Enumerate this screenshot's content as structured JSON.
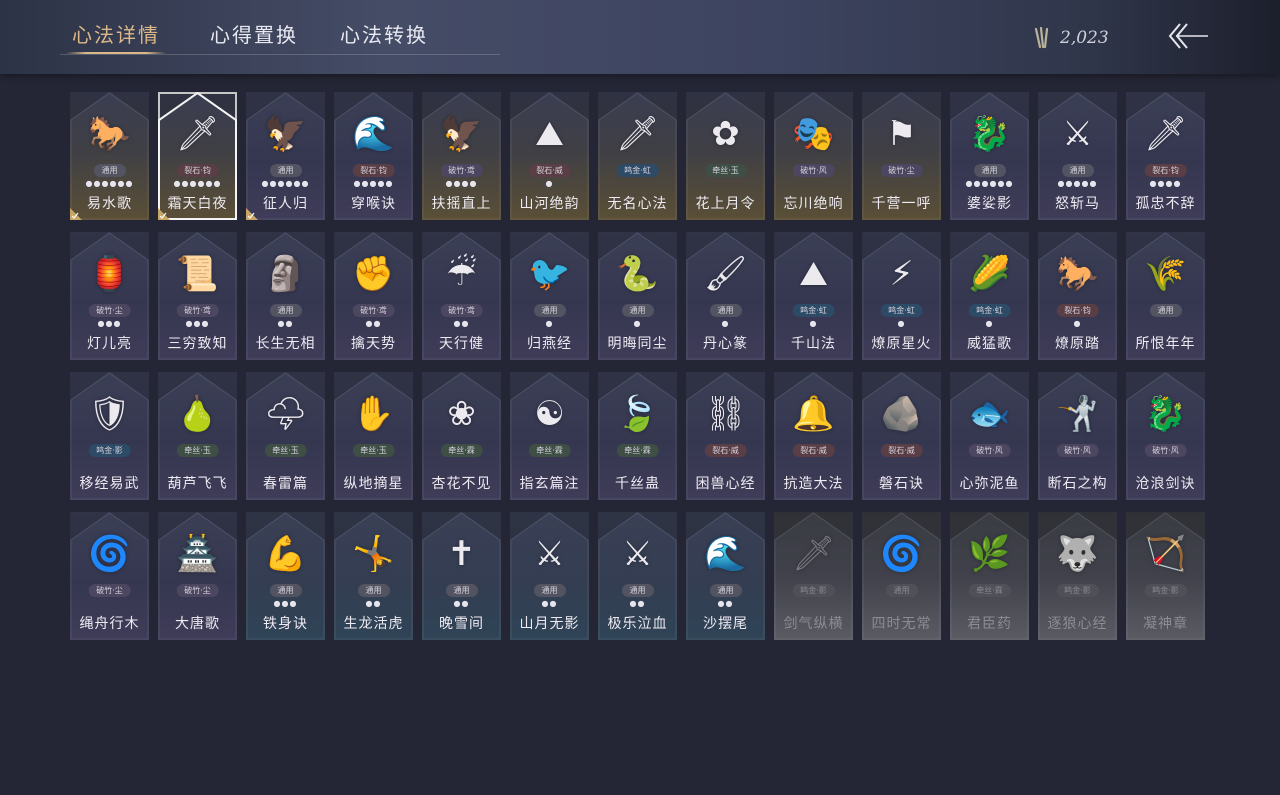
{
  "tabs": [
    {
      "label": "心法详情",
      "active": true
    },
    {
      "label": "心得置换",
      "active": false
    },
    {
      "label": "心法转换",
      "active": false
    }
  ],
  "currency": {
    "amount": "2,023",
    "icon": "arrows-bundle-icon"
  },
  "back_icon": "back-arrow-icon",
  "colors": {
    "accent": "#dcb889",
    "background": "#242635"
  },
  "cards": [
    {
      "name": "易水歌",
      "tag": "通用",
      "tagType": "general",
      "dots": "●●●●●●",
      "theme": "gold",
      "art": "🐎",
      "icon": "horse-icon",
      "check": true
    },
    {
      "name": "霜天白夜",
      "tag": "裂石·钧",
      "tagType": "red",
      "dots": "●●●●●●",
      "theme": "gold",
      "art": "🗡",
      "icon": "sword-icon",
      "check": true,
      "selected": true
    },
    {
      "name": "征人归",
      "tag": "通用",
      "tagType": "general",
      "dots": "●●●●●●",
      "theme": "normal",
      "art": "🦅",
      "icon": "eagle-icon",
      "check": true
    },
    {
      "name": "穿喉诀",
      "tag": "裂石·钧",
      "tagType": "red",
      "dots": "●●●●●",
      "theme": "normal",
      "art": "🌊",
      "icon": "wave-icon"
    },
    {
      "name": "扶摇直上",
      "tag": "破竹·鸢",
      "tagType": "purple",
      "dots": "●●●●",
      "theme": "gold",
      "art": "🦅",
      "icon": "bird-icon"
    },
    {
      "name": "山河绝韵",
      "tag": "裂石·威",
      "tagType": "red",
      "dots": "●",
      "theme": "gold",
      "art": "⛰",
      "icon": "mountain-icon"
    },
    {
      "name": "无名心法",
      "tag": "鸣金·虹",
      "tagType": "blue",
      "dots": "",
      "theme": "gold",
      "art": "🗡",
      "icon": "dagger-icon"
    },
    {
      "name": "花上月令",
      "tag": "牵丝·玉",
      "tagType": "green",
      "dots": "",
      "theme": "gold",
      "art": "✿",
      "icon": "flower-moon-icon"
    },
    {
      "name": "忘川绝响",
      "tag": "破竹·风",
      "tagType": "purple",
      "dots": "",
      "theme": "gold",
      "art": "🎭",
      "icon": "mask-icon"
    },
    {
      "name": "千营一呼",
      "tag": "破竹·尘",
      "tagType": "purple",
      "dots": "",
      "theme": "gold",
      "art": "⚑",
      "icon": "flag-icon"
    },
    {
      "name": "婆娑影",
      "tag": "通用",
      "tagType": "general",
      "dots": "●●●●●●",
      "theme": "normal",
      "art": "🐉",
      "icon": "dragon-icon"
    },
    {
      "name": "怒斩马",
      "tag": "通用",
      "tagType": "general",
      "dots": "●●●●●",
      "theme": "normal",
      "art": "⚔",
      "icon": "blade-icon"
    },
    {
      "name": "孤忠不辞",
      "tag": "裂石·钧",
      "tagType": "red",
      "dots": "●●●●",
      "theme": "normal",
      "art": "🗡",
      "icon": "spear-icon"
    },
    {
      "name": "灯儿亮",
      "tag": "破竹·尘",
      "tagType": "purple",
      "dots": "●●●",
      "theme": "normal",
      "art": "🏮",
      "icon": "lamp-icon"
    },
    {
      "name": "三穷致知",
      "tag": "破竹·鸢",
      "tagType": "purple",
      "dots": "●●●",
      "theme": "normal",
      "art": "📜",
      "icon": "scroll-icon"
    },
    {
      "name": "长生无相",
      "tag": "通用",
      "tagType": "general",
      "dots": "●●",
      "theme": "normal",
      "art": "🗿",
      "icon": "statue-icon"
    },
    {
      "name": "擒天势",
      "tag": "破竹·鸢",
      "tagType": "purple",
      "dots": "●●",
      "theme": "normal",
      "art": "✊",
      "icon": "fist-chain-icon"
    },
    {
      "name": "天行健",
      "tag": "破竹·鸢",
      "tagType": "purple",
      "dots": "●●",
      "theme": "normal",
      "art": "☔",
      "icon": "umbrella-icon"
    },
    {
      "name": "归燕经",
      "tag": "通用",
      "tagType": "general",
      "dots": "●",
      "theme": "normal",
      "art": "🐦",
      "icon": "swallow-icon"
    },
    {
      "name": "明晦同尘",
      "tag": "通用",
      "tagType": "general",
      "dots": "●",
      "theme": "normal",
      "art": "🐍",
      "icon": "snake-sword-icon"
    },
    {
      "name": "丹心篆",
      "tag": "通用",
      "tagType": "general",
      "dots": "●",
      "theme": "normal",
      "art": "🖌",
      "icon": "brush-icon"
    },
    {
      "name": "千山法",
      "tag": "鸣金·虹",
      "tagType": "blue",
      "dots": "●",
      "theme": "normal",
      "art": "⛰",
      "icon": "peaks-icon"
    },
    {
      "name": "燎原星火",
      "tag": "鸣金·虹",
      "tagType": "blue",
      "dots": "●",
      "theme": "normal",
      "art": "⚡",
      "icon": "scythe-icon"
    },
    {
      "name": "威猛歌",
      "tag": "鸣金·虹",
      "tagType": "blue",
      "dots": "●",
      "theme": "normal",
      "art": "🌽",
      "icon": "bamboo-icon"
    },
    {
      "name": "燎原踏",
      "tag": "裂石·钧",
      "tagType": "red",
      "dots": "●",
      "theme": "normal",
      "art": "🐎",
      "icon": "rearing-horse-icon"
    },
    {
      "name": "所恨年年",
      "tag": "通用",
      "tagType": "general",
      "dots": "",
      "theme": "normal",
      "art": "🌾",
      "icon": "reed-icon"
    },
    {
      "name": "移经易武",
      "tag": "鸣金·影",
      "tagType": "blue",
      "dots": "",
      "theme": "normal",
      "art": "🛡",
      "icon": "armor-icon"
    },
    {
      "name": "葫芦飞飞",
      "tag": "牵丝·玉",
      "tagType": "green",
      "dots": "",
      "theme": "normal",
      "art": "🍐",
      "icon": "gourd-icon"
    },
    {
      "name": "春雷篇",
      "tag": "牵丝·玉",
      "tagType": "green",
      "dots": "",
      "theme": "normal",
      "art": "🌩",
      "icon": "thunder-cloud-icon"
    },
    {
      "name": "纵地摘星",
      "tag": "牵丝·玉",
      "tagType": "green",
      "dots": "",
      "theme": "normal",
      "art": "✋",
      "icon": "hand-circle-icon"
    },
    {
      "name": "杏花不见",
      "tag": "牵丝·霖",
      "tagType": "green",
      "dots": "",
      "theme": "normal",
      "art": "❀",
      "icon": "blossom-icon"
    },
    {
      "name": "指玄篇注",
      "tag": "牵丝·霖",
      "tagType": "green",
      "dots": "",
      "theme": "normal",
      "art": "☯",
      "icon": "yinyang-icon"
    },
    {
      "name": "千丝蛊",
      "tag": "牵丝·霖",
      "tagType": "green",
      "dots": "",
      "theme": "normal",
      "art": "🍃",
      "icon": "leaf-icon"
    },
    {
      "name": "困兽心经",
      "tag": "裂石·威",
      "tagType": "red",
      "dots": "",
      "theme": "normal",
      "art": "⛓",
      "icon": "shackle-icon"
    },
    {
      "name": "抗造大法",
      "tag": "裂石·威",
      "tagType": "red",
      "dots": "",
      "theme": "normal",
      "art": "🔔",
      "icon": "bell-icon"
    },
    {
      "name": "磐石诀",
      "tag": "裂石·威",
      "tagType": "red",
      "dots": "",
      "theme": "normal",
      "art": "🪨",
      "icon": "rock-icon"
    },
    {
      "name": "心弥泥鱼",
      "tag": "破竹·风",
      "tagType": "purple",
      "dots": "",
      "theme": "normal",
      "art": "🐟",
      "icon": "fish-icon"
    },
    {
      "name": "断石之构",
      "tag": "破竹·风",
      "tagType": "purple",
      "dots": "",
      "theme": "normal",
      "art": "🤺",
      "icon": "warrior-icon"
    },
    {
      "name": "沧浪剑诀",
      "tag": "破竹·风",
      "tagType": "purple",
      "dots": "",
      "theme": "normal",
      "art": "🐉",
      "icon": "serpent-icon"
    },
    {
      "name": "绳舟行木",
      "tag": "破竹·尘",
      "tagType": "purple",
      "dots": "",
      "theme": "normal",
      "art": "🌀",
      "icon": "storm-icon"
    },
    {
      "name": "大唐歌",
      "tag": "破竹·尘",
      "tagType": "purple",
      "dots": "",
      "theme": "normal",
      "art": "🏯",
      "icon": "palace-icon"
    },
    {
      "name": "铁身诀",
      "tag": "通用",
      "tagType": "general",
      "dots": "●●●",
      "theme": "blue",
      "art": "💪",
      "icon": "strong-body-icon"
    },
    {
      "name": "生龙活虎",
      "tag": "通用",
      "tagType": "general",
      "dots": "●●",
      "theme": "blue",
      "art": "🤸",
      "icon": "leaping-figure-icon"
    },
    {
      "name": "晚雪间",
      "tag": "通用",
      "tagType": "general",
      "dots": "●●",
      "theme": "blue",
      "art": "✝",
      "icon": "cross-blade-icon"
    },
    {
      "name": "山月无影",
      "tag": "通用",
      "tagType": "general",
      "dots": "●●",
      "theme": "blue",
      "art": "⚔",
      "icon": "twin-blades-icon"
    },
    {
      "name": "极乐泣血",
      "tag": "通用",
      "tagType": "general",
      "dots": "●●",
      "theme": "blue",
      "art": "⚔",
      "icon": "crossed-blades-icon"
    },
    {
      "name": "沙摆尾",
      "tag": "通用",
      "tagType": "general",
      "dots": "●●",
      "theme": "blue",
      "art": "🌊",
      "icon": "tail-wave-icon"
    },
    {
      "name": "剑气纵横",
      "tag": "鸣金·影",
      "tagType": "blue",
      "dots": "",
      "theme": "locked",
      "art": "🗡",
      "icon": "locked-sword-icon"
    },
    {
      "name": "四时无常",
      "tag": "通用",
      "tagType": "general",
      "dots": "",
      "theme": "locked",
      "art": "🌀",
      "icon": "locked-swirl-icon"
    },
    {
      "name": "君臣药",
      "tag": "牵丝·霖",
      "tagType": "green",
      "dots": "",
      "theme": "locked",
      "art": "🌿",
      "icon": "locked-herb-icon"
    },
    {
      "name": "逐狼心经",
      "tag": "鸣金·影",
      "tagType": "blue",
      "dots": "",
      "theme": "locked",
      "art": "🐺",
      "icon": "locked-wolf-icon"
    },
    {
      "name": "凝神章",
      "tag": "鸣金·影",
      "tagType": "blue",
      "dots": "",
      "theme": "locked",
      "art": "🏹",
      "icon": "locked-bow-icon"
    }
  ]
}
